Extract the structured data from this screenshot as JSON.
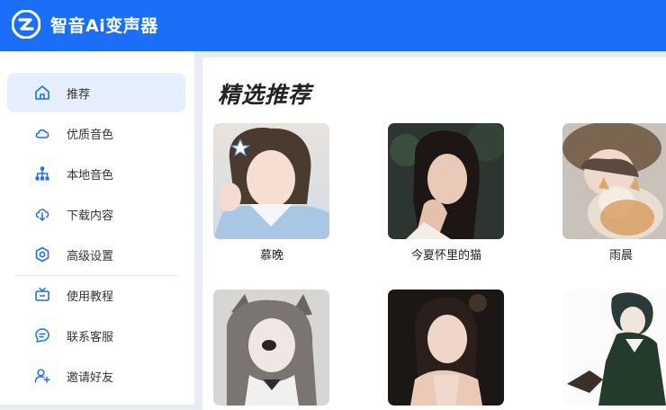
{
  "app": {
    "title": "智音Ai变声器",
    "brand_color": "#1a6ef7"
  },
  "sidebar": {
    "items": [
      {
        "label": "推荐",
        "icon": "home-icon",
        "active": true
      },
      {
        "label": "优质音色",
        "icon": "cloud-icon",
        "active": false
      },
      {
        "label": "本地音色",
        "icon": "hierarchy-icon",
        "active": false
      },
      {
        "label": "下载内容",
        "icon": "download-icon",
        "active": false
      },
      {
        "label": "高级设置",
        "icon": "settings-hex-icon",
        "active": false
      },
      {
        "label": "使用教程",
        "icon": "tv-icon",
        "active": false
      },
      {
        "label": "联系客服",
        "icon": "chat-icon",
        "active": false
      },
      {
        "label": "邀请好友",
        "icon": "add-user-icon",
        "active": false
      }
    ]
  },
  "main": {
    "section_title": "精选推荐",
    "cards": [
      {
        "name": "慕晚"
      },
      {
        "name": "今夏怀里的猫"
      },
      {
        "name": "雨晨"
      },
      {
        "name": ""
      },
      {
        "name": ""
      },
      {
        "name": ""
      }
    ]
  }
}
